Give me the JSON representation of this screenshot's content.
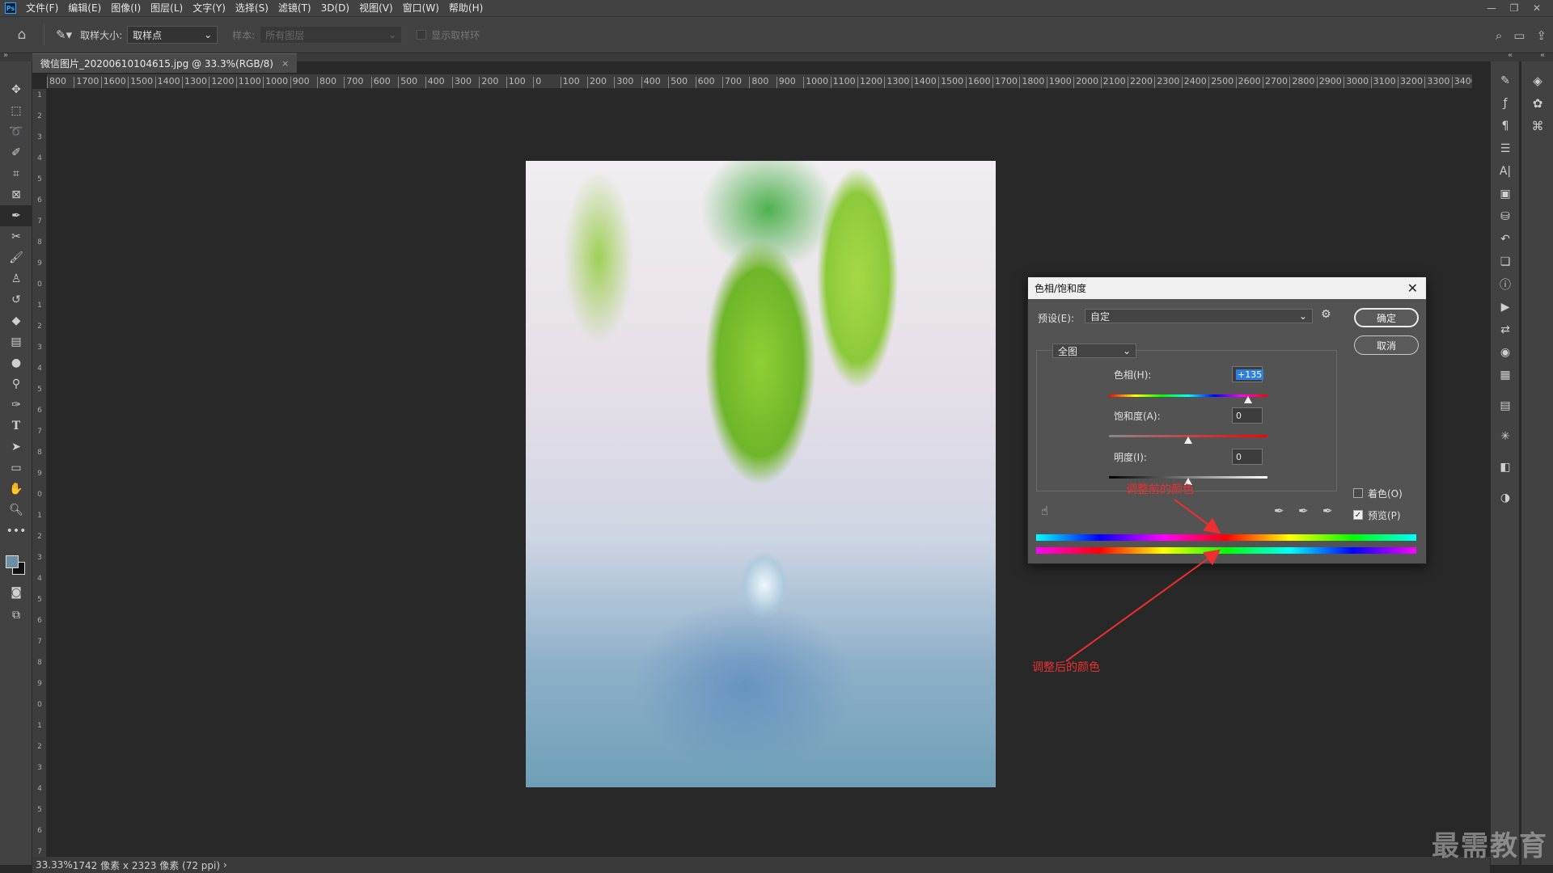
{
  "menubar": {
    "logo": "Ps",
    "items": [
      "文件(F)",
      "编辑(E)",
      "图像(I)",
      "图层(L)",
      "文字(Y)",
      "选择(S)",
      "滤镜(T)",
      "3D(D)",
      "视图(V)",
      "窗口(W)",
      "帮助(H)"
    ]
  },
  "options": {
    "sample_size_label": "取样大小:",
    "sample_size_value": "取样点",
    "sample_label": "样本:",
    "sample_value": "所有图层",
    "show_ring_label": "显示取样环"
  },
  "document": {
    "tab_title": "微信图片_20200610104615.jpg @ 33.3%(RGB/8)",
    "tab_close": "×"
  },
  "ruler": {
    "h_ticks": [
      "800",
      "1700",
      "1600",
      "1500",
      "1400",
      "1300",
      "1200",
      "1100",
      "1000",
      "900",
      "800",
      "700",
      "600",
      "500",
      "400",
      "300",
      "200",
      "100",
      "0",
      "100",
      "200",
      "300",
      "400",
      "500",
      "600",
      "700",
      "800",
      "900",
      "1000",
      "1100",
      "1200",
      "1300",
      "1400",
      "1500",
      "1600",
      "1700",
      "1800",
      "1900",
      "2000",
      "2100",
      "2200",
      "2300",
      "2400",
      "2500",
      "2600",
      "2700",
      "2800",
      "2900",
      "3000",
      "3100",
      "3200",
      "3300",
      "3400"
    ],
    "v_ticks": [
      "1",
      "2",
      "3",
      "4",
      "5",
      "6",
      "7",
      "8",
      "9",
      "0",
      "1",
      "2",
      "3",
      "4",
      "5",
      "6",
      "7",
      "8",
      "9",
      "0",
      "1",
      "2",
      "3",
      "4",
      "5",
      "6",
      "7",
      "8",
      "9",
      "0",
      "1",
      "2",
      "3",
      "4",
      "5",
      "6",
      "7"
    ]
  },
  "dialog": {
    "title": "色相/饱和度",
    "preset_label": "预设(E):",
    "preset_value": "自定",
    "ok": "确定",
    "cancel": "取消",
    "channel": "全图",
    "hue_label": "色相(H):",
    "hue_value": "+135",
    "saturation_label": "饱和度(A):",
    "saturation_value": "0",
    "lightness_label": "明度(I):",
    "lightness_value": "0",
    "colorize_label": "着色(O)",
    "preview_label": "预览(P)",
    "colorize_checked": false,
    "preview_checked": true,
    "hue_level": 135,
    "saturation_level": 0,
    "lightness_level": 0
  },
  "annotations": {
    "before": "调整前的颜色",
    "after": "调整后的颜色",
    "color": "#ef2f2f"
  },
  "status": {
    "zoom": "33.33%",
    "info": "1742 像素 x 2323 像素 (72 ppi)"
  },
  "watermark": "最需教育",
  "tools": [
    "move-icon",
    "marquee-icon",
    "lasso-icon",
    "quick-select-icon",
    "crop-icon",
    "frame-icon",
    "eyedropper-icon",
    "healing-icon",
    "brush-icon",
    "stamp-icon",
    "history-brush-icon",
    "eraser-icon",
    "gradient-icon",
    "blur-icon",
    "dodge-icon",
    "pen-icon",
    "type-icon",
    "path-select-icon",
    "rectangle-icon",
    "hand-icon",
    "zoom-icon",
    "more-icon"
  ]
}
